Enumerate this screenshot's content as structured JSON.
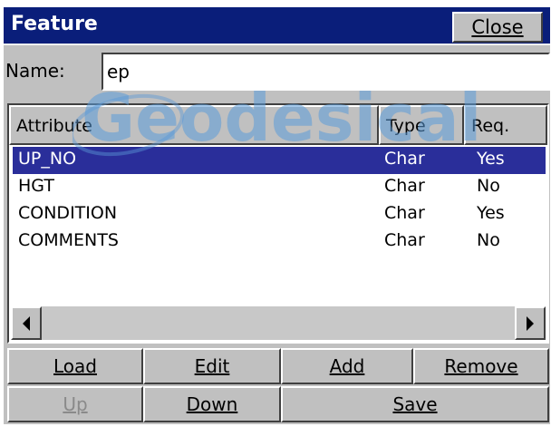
{
  "window": {
    "title": "Feature",
    "close_label": "Close"
  },
  "name_field": {
    "label": "Name:",
    "value": "ep"
  },
  "watermark": {
    "text": "Geodesical"
  },
  "table": {
    "columns": [
      "Attribute",
      "Type",
      "Req."
    ],
    "rows": [
      {
        "attribute": "UP_NO",
        "type": "Char",
        "req": "Yes",
        "selected": true
      },
      {
        "attribute": "HGT",
        "type": "Char",
        "req": "No",
        "selected": false
      },
      {
        "attribute": "CONDITION",
        "type": "Char",
        "req": "Yes",
        "selected": false
      },
      {
        "attribute": "COMMENTS",
        "type": "Char",
        "req": "No",
        "selected": false
      }
    ]
  },
  "scrollbar": {
    "left_icon": "arrow-left-icon",
    "right_icon": "arrow-right-icon"
  },
  "buttons": {
    "load": "Load",
    "edit": "Edit",
    "add": "Add",
    "remove": "Remove",
    "up": "Up",
    "down": "Down",
    "save": "Save"
  },
  "colors": {
    "title_bg": "#0a1e7a",
    "selection_bg": "#2a2e9a",
    "face": "#c0c0c0",
    "watermark": "#5a9ad8"
  }
}
